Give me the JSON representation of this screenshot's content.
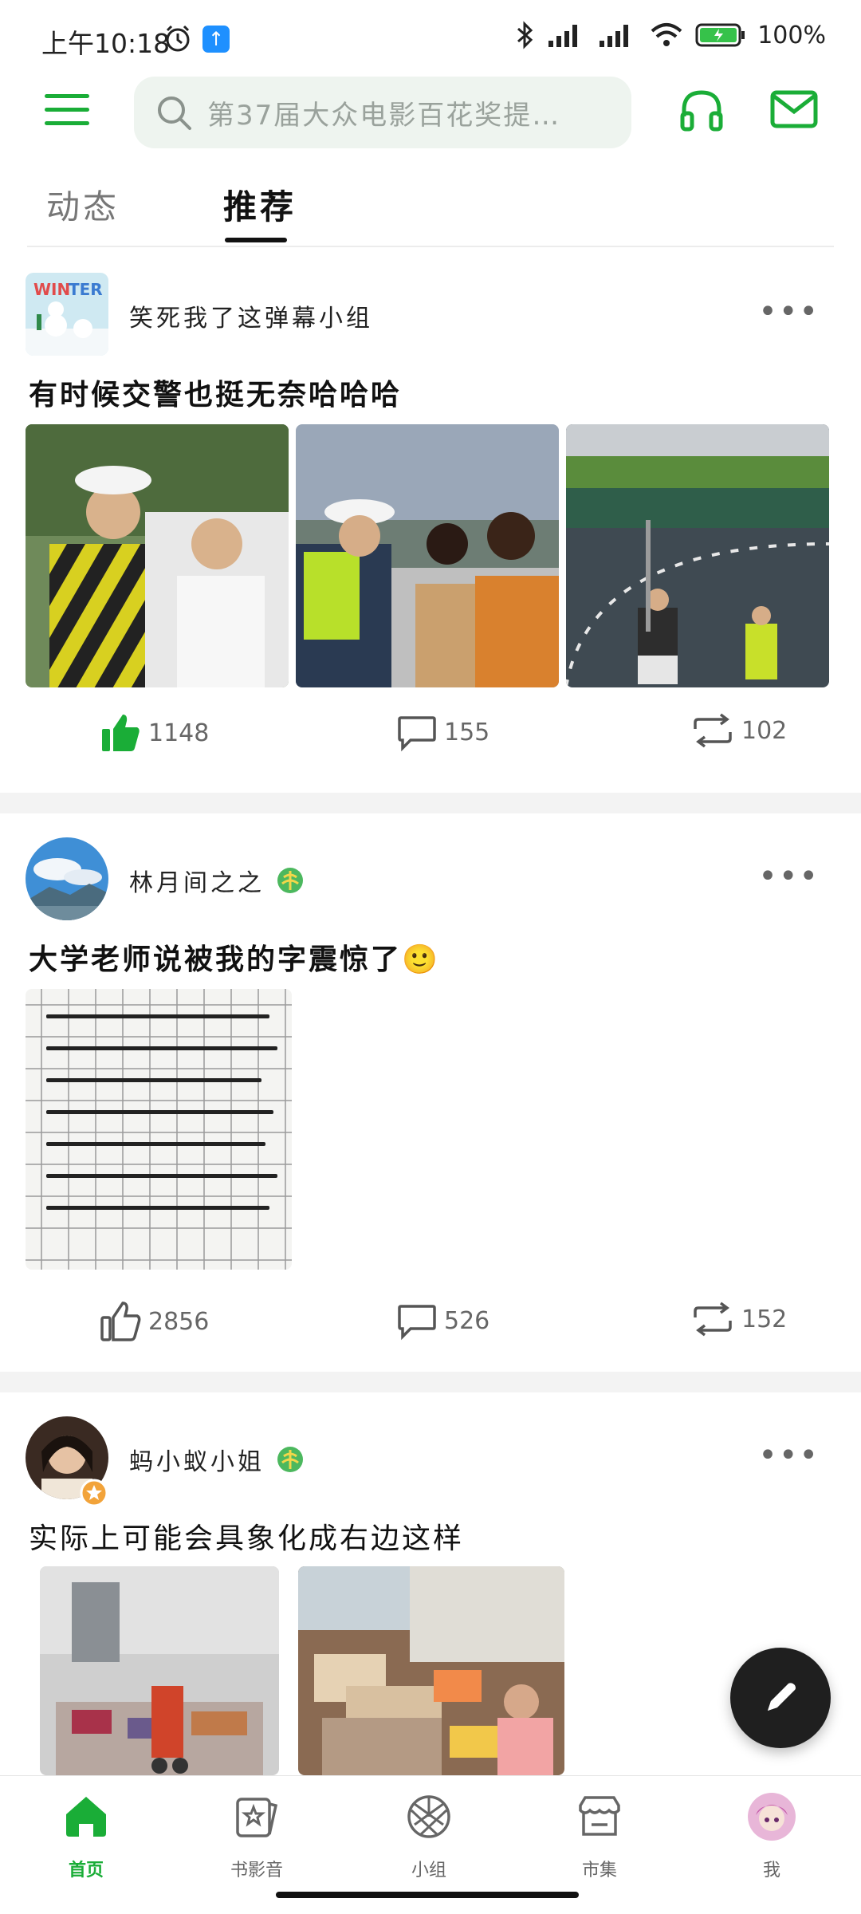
{
  "status_bar": {
    "time": "上午10:18",
    "battery": "100%"
  },
  "header": {
    "search_placeholder": "第37届大众电影百花奖提…"
  },
  "tabs": [
    {
      "label": "动态"
    },
    {
      "label": "推荐"
    }
  ],
  "posts": [
    {
      "author": "笑死我了这弹幕小组",
      "title": "有时候交警也挺无奈哈哈哈",
      "likes": "1148",
      "comments": "155",
      "reposts": "102"
    },
    {
      "author": "林月间之之",
      "title": "大学老师说被我的字震惊了🙂",
      "likes": "2856",
      "comments": "526",
      "reposts": "152"
    },
    {
      "author": "蚂小蚁小姐",
      "title": "实际上可能会具象化成右边这样"
    }
  ],
  "bottom_nav": [
    {
      "label": "首页"
    },
    {
      "label": "书影音"
    },
    {
      "label": "小组"
    },
    {
      "label": "市集"
    },
    {
      "label": "我"
    }
  ],
  "colors": {
    "accent": "#1aad37"
  }
}
